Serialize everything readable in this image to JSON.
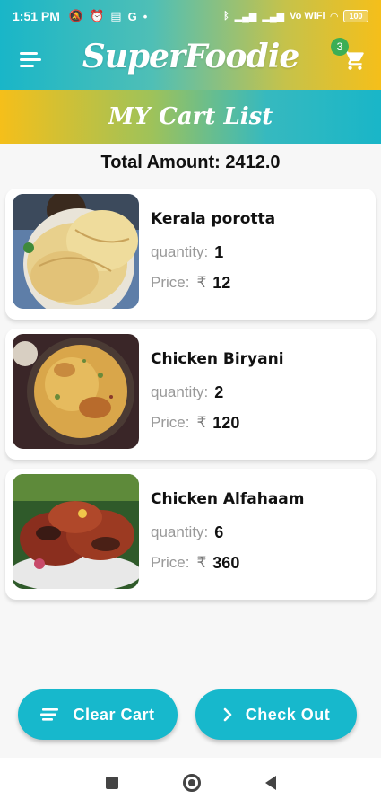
{
  "status": {
    "time": "1:51 PM",
    "icons": [
      "silent-bell-icon",
      "alarm-icon",
      "message-icon",
      "google-icon",
      "dot-icon"
    ],
    "right_icons": [
      "bluetooth-icon",
      "signal-icon",
      "signal-icon",
      "wifi-icon"
    ],
    "network": "Vo WiFi",
    "battery": "100"
  },
  "app": {
    "brand": "SuperFoodie",
    "cart_count": "3",
    "page_title": "MY Cart List"
  },
  "total": {
    "label": "Total Amount: 2412.0"
  },
  "items": [
    {
      "name": "Kerala porotta",
      "quantity_label": "quantity:",
      "quantity": "1",
      "price_label": "Price:",
      "currency": "₹",
      "price": "12"
    },
    {
      "name": "Chicken Biryani",
      "quantity_label": "quantity:",
      "quantity": "2",
      "price_label": "Price:",
      "currency": "₹",
      "price": "120"
    },
    {
      "name": "Chicken Alfahaam",
      "quantity_label": "quantity:",
      "quantity": "6",
      "price_label": "Price:",
      "currency": "₹",
      "price": "360"
    }
  ],
  "actions": {
    "clear_label": "Clear Cart",
    "checkout_label": "Check Out"
  },
  "colors": {
    "accent": "#17b8cc",
    "gradient_teal": "#19b6c8",
    "gradient_yellow": "#f5bf1a",
    "badge_green": "#3cae55"
  }
}
